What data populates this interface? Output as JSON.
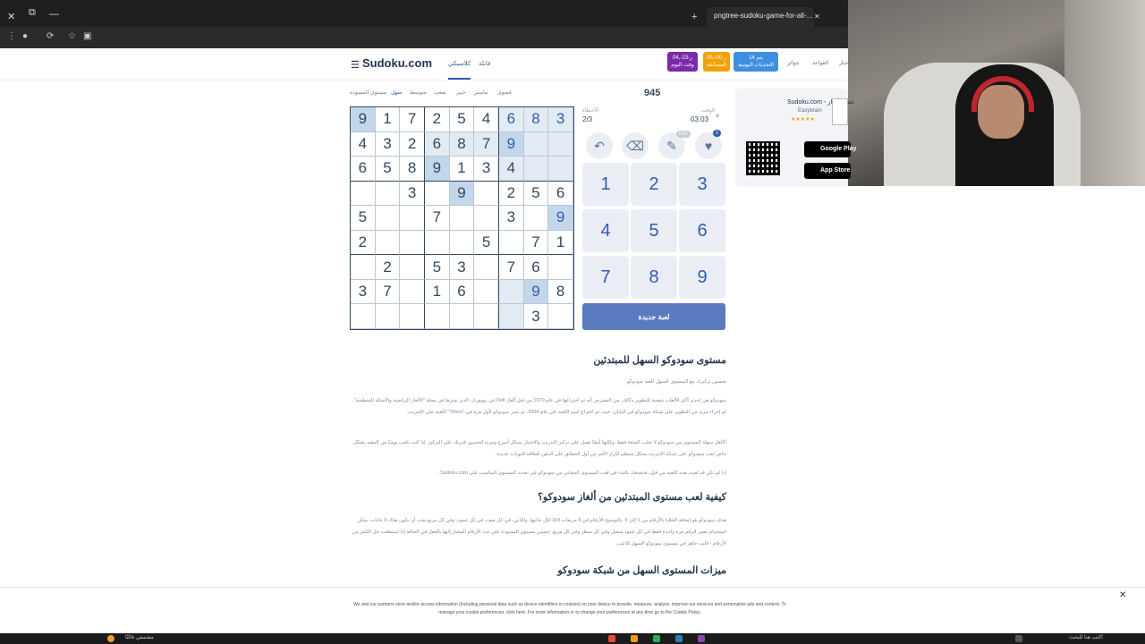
{
  "browser": {
    "tabs": [
      {
        "label": "pngtree-sudoku-game-for-all-..."
      }
    ]
  },
  "site": {
    "logo": "Sudoku.com",
    "nav": [
      "كلاسيكي",
      "قاتلة"
    ],
    "top_links": [
      "القواعد",
      "جوائز",
      "أخبار"
    ],
    "badges": [
      {
        "line1": "04,-23-ر",
        "line2": "وقت اليوم",
        "color": "#7a2aa8"
      },
      {
        "line1": "05,-00-ر",
        "line2": "المسابقة",
        "color": "#f2a007"
      },
      {
        "line1": "يتم 14",
        "line2": "التحديات اليومية",
        "color": "#3f8fe0"
      }
    ]
  },
  "difficulty": {
    "options": [
      "مستوى المسودة",
      "سهل",
      "متوسط",
      "صعب",
      "خبير",
      "ماستر",
      "قصوى"
    ],
    "selected": "سهل"
  },
  "game": {
    "score": "945",
    "mistakes_label": "الأخطاء",
    "mistakes": "2/3",
    "time_label": "الوقت",
    "time": "03:03",
    "pause_icon": "pause-icon",
    "tools": [
      {
        "name": "undo-icon",
        "glyph": "↶"
      },
      {
        "name": "eraser-icon",
        "glyph": "⌫"
      },
      {
        "name": "pencil-icon",
        "glyph": "✎",
        "badge": "OFF"
      },
      {
        "name": "hint-icon",
        "glyph": "💡",
        "badge": "3"
      }
    ],
    "numpad": [
      "1",
      "2",
      "3",
      "4",
      "5",
      "6",
      "7",
      "8",
      "9"
    ],
    "new_game_label": "لعبة جديدة",
    "grid": [
      [
        {
          "v": "9",
          "hl": "same"
        },
        {
          "v": "1"
        },
        {
          "v": "7"
        },
        {
          "v": "2"
        },
        {
          "v": "5"
        },
        {
          "v": "4"
        },
        {
          "v": "6",
          "hl": "hl",
          "user": true
        },
        {
          "v": "8",
          "hl": "hl",
          "user": true
        },
        {
          "v": "3",
          "hl": "hl",
          "user": true
        }
      ],
      [
        {
          "v": "4"
        },
        {
          "v": "3"
        },
        {
          "v": "2"
        },
        {
          "v": "6",
          "hl": "hl"
        },
        {
          "v": "8",
          "hl": "hl"
        },
        {
          "v": "7",
          "hl": "hl"
        },
        {
          "v": "9",
          "hl": "same",
          "user": true
        },
        {
          "v": "",
          "hl": "hl"
        },
        {
          "v": "",
          "hl": "hl"
        }
      ],
      [
        {
          "v": "6"
        },
        {
          "v": "5"
        },
        {
          "v": "8"
        },
        {
          "v": "9",
          "hl": "same"
        },
        {
          "v": "1"
        },
        {
          "v": "3"
        },
        {
          "v": "4",
          "hl": "hl"
        },
        {
          "v": "",
          "hl": "hl"
        },
        {
          "v": "",
          "hl": "hl"
        }
      ],
      [
        {
          "v": ""
        },
        {
          "v": ""
        },
        {
          "v": "3"
        },
        {
          "v": ""
        },
        {
          "v": "9",
          "hl": "same"
        },
        {
          "v": ""
        },
        {
          "v": "2"
        },
        {
          "v": "5"
        },
        {
          "v": "6"
        }
      ],
      [
        {
          "v": "5"
        },
        {
          "v": ""
        },
        {
          "v": ""
        },
        {
          "v": "7"
        },
        {
          "v": ""
        },
        {
          "v": ""
        },
        {
          "v": "3"
        },
        {
          "v": ""
        },
        {
          "v": "9",
          "hl": "same",
          "user": true
        }
      ],
      [
        {
          "v": "2"
        },
        {
          "v": ""
        },
        {
          "v": ""
        },
        {
          "v": ""
        },
        {
          "v": ""
        },
        {
          "v": "5"
        },
        {
          "v": ""
        },
        {
          "v": "7"
        },
        {
          "v": "1"
        }
      ],
      [
        {
          "v": ""
        },
        {
          "v": "2"
        },
        {
          "v": ""
        },
        {
          "v": "5"
        },
        {
          "v": "3"
        },
        {
          "v": ""
        },
        {
          "v": "7"
        },
        {
          "v": "6"
        },
        {
          "v": ""
        }
      ],
      [
        {
          "v": "3"
        },
        {
          "v": "7"
        },
        {
          "v": ""
        },
        {
          "v": "1"
        },
        {
          "v": "6"
        },
        {
          "v": ""
        },
        {
          "v": "",
          "hl": "hl"
        },
        {
          "v": "9",
          "hl": "same",
          "user": true
        },
        {
          "v": "8"
        }
      ],
      [
        {
          "v": ""
        },
        {
          "v": ""
        },
        {
          "v": ""
        },
        {
          "v": ""
        },
        {
          "v": ""
        },
        {
          "v": ""
        },
        {
          "v": "",
          "hl": "hl"
        },
        {
          "v": "3"
        },
        {
          "v": ""
        }
      ]
    ]
  },
  "side_card": {
    "title": "Sudoku.com - عقد الألغاز",
    "publisher": "Easybrain",
    "stars": "★★★★★",
    "google_play": "Google Play",
    "app_store": "App Store"
  },
  "article": {
    "h1": "مستوى سودوكو السهل للمبتدئين",
    "p0": "تحسين تركيزك مع المستوى السهل للعبة سودوكو.",
    "p1": "سودوكو هي إحدى أكثر الألعاب شعبية للتطوير ذكائك. من المفترض أنه تم اختراعها في عام 1970 من قبل ألغاز Dell في نيويورك، الذي نشرها في مجلة \"الألغاز الرياضية والأسئلة المنطقية\". ثم إجراء مزيد من التطوير على شبكة سودوكو في اليابان، حيث تم اختراع اسم اللعبة. في عام 2004، تم نشر سودوكو لأول مرة في \"Times\" اللعبة على الإنترنت.",
    "p2": "الألغاز سهلة المستوى من سودوكو لا تجلب المتعة فقط، ولكنها أيضًا تعمل على تركيز التدريب والاختبار بشكل أسرع ومرنة لتحسين قدرتك على التركيز. إذا كنت تلعب يوميًا من المفيد بشكل خاص لعب سودوكو على شبكة الإنترنت بشكل منتظم لكرار الأمر من أول الحقائق على الذهن للطاقة للتويات عديدة.",
    "p3": "إذا لم تكن قد لعبت هذه اللعبة من قبل، فننصحك بالبدء في لعب المستوى المجاني من سودوكو عبر تحديد المستوى المناسب على Sudoku.com.",
    "h2": "كيفية لعب مستوى المبتدئين من ألغاز سودوكو؟",
    "p4": "هدف سودوكو هو إضافة الخلايا بالأرقام من 1 إلى 9. بالتوضيح الأرقام في 9 مربعات 3x3 لكل جانبها، والثاني، في كل صف، في كل عمود، وفي كل مربع يجب أن يكون هناك 9 خانات. يمكن استخدام نفس الرقم مرة واحدة فقط في كل عمود متصل وفي كل سطر وفي كل مربع. يتضمن مستوى المسودة على عدد الأرقام المشار إليها بالفعل في الحافة إذا استطعت حل الكثير من الأرقام - فأنت جاهز في مستوى سودوكو السهل للاعب.",
    "h3": "ميزات المستوى السهل من شبكة سودوكو"
  },
  "cookie": {
    "text": "We and our partners store and/or access information (including personal data such as device identifiers in cookies) on your device to provide, measure, analyze, improve our services and personalize ads and content. To manage your cookie preferences, click here. For more information or to change your preferences at any time go to the Cookie Policy."
  },
  "taskbar": {
    "left_text": "مشمس غالبًا",
    "right_text": "اكتب هنا للبحث"
  }
}
